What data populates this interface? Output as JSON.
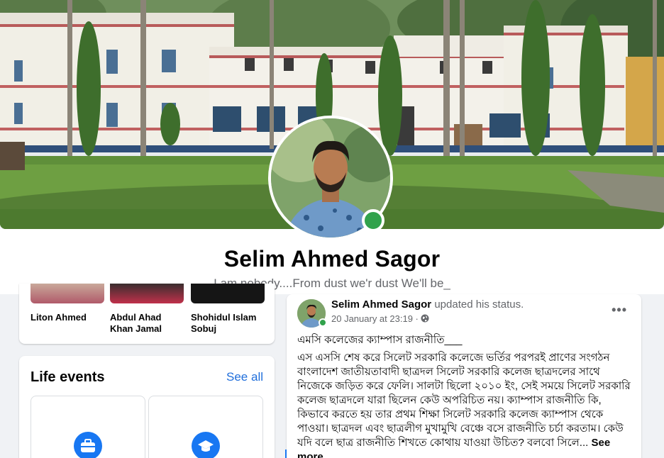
{
  "profile": {
    "name": "Selim Ahmed Sagor",
    "bio": "I am nobody....From dust we'r dust We'll be_"
  },
  "friends": [
    {
      "name": "Liton Ahmed"
    },
    {
      "name": "Abdul Ahad Khan Jamal"
    },
    {
      "name": "Shohidul Islam Sobuj"
    }
  ],
  "life_events": {
    "title": "Life events",
    "see_all": "See all",
    "items": [
      {
        "icon": "briefcase-icon"
      },
      {
        "icon": "graduation-cap-icon"
      }
    ]
  },
  "post": {
    "author": "Selim Ahmed Sagor",
    "action": "updated his status.",
    "time": "20 January at 23:19 ·",
    "privacy_icon": "globe-icon",
    "more": "•••",
    "headline": "এমসি কলেজের ক্যাম্পাস রাজনীতি___",
    "body": "এস এসসি শেষ  করে  সিলেট সরকারি কলেজে ভর্তির পরপরই প্রাণের সংগঠন বাংলাদেশ জাতীয়তাবাদী ছাত্রদল সিলেট সরকারি কলেজ ছাত্রদলের সাথে নিজেকে জড়িত করে ফেলি। সালটা ছিলো ২০১০ ইং, সেই সময়ে সিলেট সরকারি কলেজ ছাত্রদলে যারা ছিলেন কেউ অপরিচিত নয়। ক্যাম্পাস রাজনীতি কি, কিভাবে করতে হয় তার প্রথম শিক্ষা সিলেট সরকারি কলেজ ক্যাম্পাস থেকে পাওয়া। ছাত্রদল এবং ছাত্রলীগ মুখামুখি বেঞ্চে বসে রাজনীতি চর্চা করতাম। কেউ যদি বলে ছাত্র রাজনীতি শিখতে কোথায় যাওয়া উচিত? বলবো সিলে...",
    "see_more": "See more"
  },
  "colors": {
    "accent": "#1877f2",
    "online": "#31a24c",
    "link": "#216fdb",
    "secondary_text": "#65676b"
  }
}
